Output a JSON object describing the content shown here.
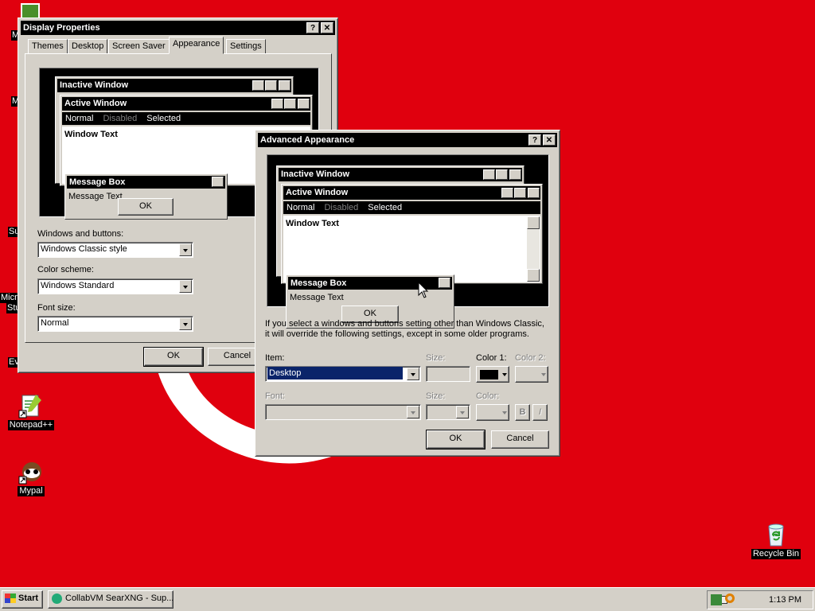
{
  "desktop": {
    "icons": [
      {
        "label": "Notepad++"
      },
      {
        "label": "Mypal"
      },
      {
        "label": "Recycle Bin"
      }
    ],
    "cut_labels": [
      "M",
      "M",
      "Su",
      "Micro",
      "Stu",
      "Ev"
    ]
  },
  "display_properties": {
    "title": "Display Properties",
    "tabs": [
      "Themes",
      "Desktop",
      "Screen Saver",
      "Appearance",
      "Settings"
    ],
    "active_tab": "Appearance",
    "preview": {
      "inactive_title": "Inactive Window",
      "active_title": "Active Window",
      "menu": [
        "Normal",
        "Disabled",
        "Selected"
      ],
      "window_text": "Window Text",
      "msgbox_title": "Message Box",
      "msgbox_text": "Message Text",
      "ok": "OK"
    },
    "windows_buttons_label": "Windows and buttons:",
    "windows_buttons_value": "Windows Classic style",
    "color_scheme_label": "Color scheme:",
    "color_scheme_value": "Windows Standard",
    "font_size_label": "Font size:",
    "font_size_value": "Normal",
    "ok": "OK",
    "cancel": "Cancel"
  },
  "advanced": {
    "title": "Advanced Appearance",
    "preview": {
      "inactive_title": "Inactive Window",
      "active_title": "Active Window",
      "menu": [
        "Normal",
        "Disabled",
        "Selected"
      ],
      "window_text": "Window Text",
      "msgbox_title": "Message Box",
      "msgbox_text": "Message Text",
      "ok": "OK"
    },
    "info_line1": "If you select a windows and buttons setting other than Windows Classic,",
    "info_line2": "it will override the following settings, except in some older programs.",
    "item_label": "Item:",
    "item_value": "Desktop",
    "size_label": "Size:",
    "color1_label": "Color 1:",
    "color2_label": "Color 2:",
    "font_label": "Font:",
    "font_size_label": "Size:",
    "font_color_label": "Color:",
    "bold": "B",
    "italic": "I",
    "ok": "OK",
    "cancel": "Cancel"
  },
  "taskbar": {
    "start": "Start",
    "task": "CollabVM SearXNG - Sup...",
    "clock": "1:13 PM"
  },
  "colors": {
    "desktop": "#e0000e",
    "face": "#d4d0c8",
    "selection": "#0a246a"
  }
}
